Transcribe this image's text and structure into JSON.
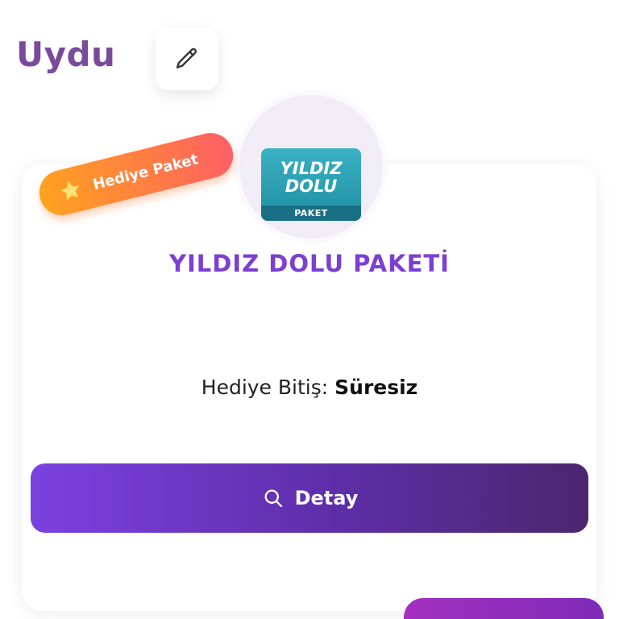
{
  "header": {
    "title": "Uydu",
    "edit_icon": "pencil-icon"
  },
  "package": {
    "badge": {
      "label": "Hediye Paket",
      "icon": "star-icon",
      "colors": [
        "#ffa21f",
        "#ff5f66"
      ]
    },
    "logo": {
      "text": "YILDIZ\nDOLU",
      "strip_text": "PAKET",
      "color": "#2aa0b4"
    },
    "name": "YILDIZ DOLU PAKETİ",
    "expiry_label": "Hediye Bitiş:",
    "expiry_value": "Süresiz",
    "detail_button": {
      "label": "Detay",
      "icon": "search-icon"
    }
  },
  "colors": {
    "title": "#7a4a9b",
    "package_name": "#7b3fd1",
    "button_start": "#7b41e0",
    "button_end": "#4b266e"
  }
}
